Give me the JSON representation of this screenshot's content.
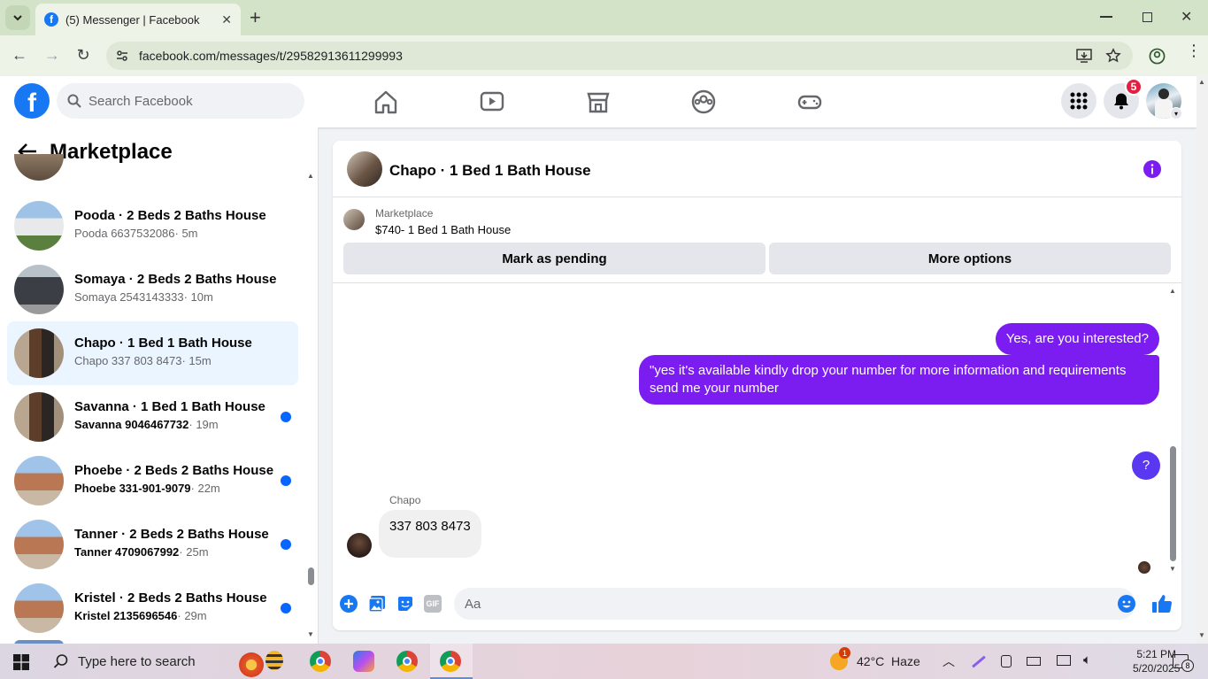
{
  "browser": {
    "tab_title": "(5) Messenger | Facebook",
    "url": "facebook.com/messages/t/29582913611299993"
  },
  "header": {
    "search_placeholder": "Search Facebook",
    "notification_count": "5",
    "brand_color": "#1877f2"
  },
  "sidebar": {
    "title": "Marketplace",
    "items": [
      {
        "name": "Pooda · 2 Beds 2 Baths House",
        "who": "Pooda 6637532086",
        "time": "· 5m",
        "unread": false,
        "active": false,
        "thumb": "house-blue"
      },
      {
        "name": "Somaya · 2 Beds 2 Baths House",
        "who": "Somaya 2543143333",
        "time": "· 10m",
        "unread": false,
        "active": false,
        "thumb": "house-grey"
      },
      {
        "name": "Chapo · 1 Bed 1 Bath House",
        "who": "Chapo 337 803 8473",
        "time": "· 15m",
        "unread": false,
        "active": true,
        "thumb": "kitchen"
      },
      {
        "name": "Savanna · 1 Bed 1 Bath House",
        "who": "Savanna 9046467732",
        "time": "· 19m",
        "unread": true,
        "active": false,
        "thumb": "kitchen"
      },
      {
        "name": "Phoebe · 2 Beds 2 Baths House",
        "who": "Phoebe 331-901-9079",
        "time": "· 22m",
        "unread": true,
        "active": false,
        "thumb": "house-brick"
      },
      {
        "name": "Tanner · 2 Beds 2 Baths House",
        "who": "Tanner 4709067992",
        "time": "· 25m",
        "unread": true,
        "active": false,
        "thumb": "house-brick"
      },
      {
        "name": "Kristel · 2 Beds 2 Baths House",
        "who": "Kristel 2135696546",
        "time": "· 29m",
        "unread": true,
        "active": false,
        "thumb": "house-brick"
      }
    ]
  },
  "chat": {
    "title": "Chapo · 1 Bed 1 Bath House",
    "listing_label": "Marketplace",
    "listing_detail": "$740- 1 Bed 1 Bath House",
    "mark_pending": "Mark as pending",
    "more_options": "More options",
    "messages": {
      "out1": "Yes, are you interested?",
      "out2": "\"yes it's available kindly drop your number for more information and requirements send me your number",
      "out3": "?",
      "in_sender": "Chapo",
      "in1": "337 803 8473"
    },
    "composer_placeholder": "Aa",
    "accent_color": "#7b1cf0"
  },
  "taskbar": {
    "search_placeholder": "Type here to search",
    "weather": "42°C  Haze",
    "weather_badge": "1",
    "time": "5:21 PM",
    "date": "5/20/2025",
    "notif_count": "8"
  }
}
